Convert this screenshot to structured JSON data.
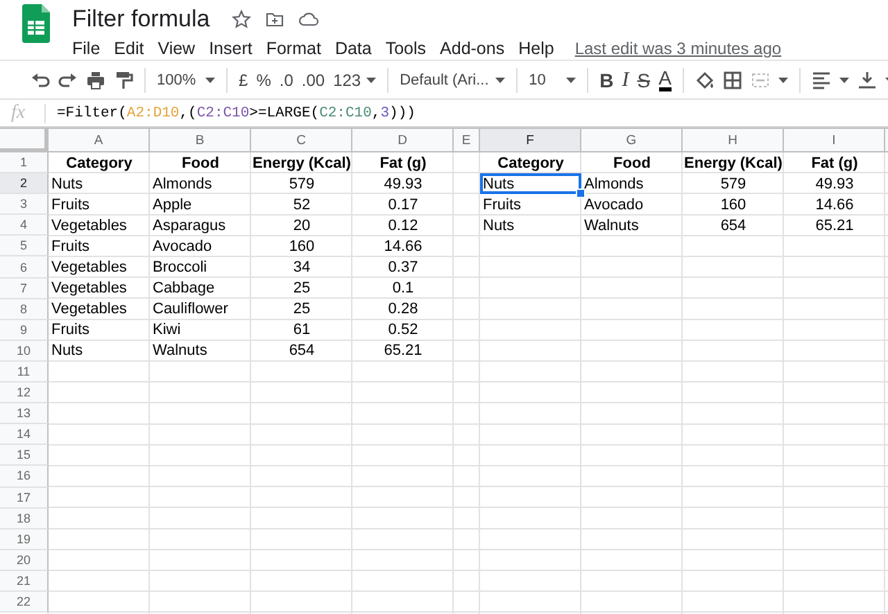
{
  "document": {
    "title": "Filter formula",
    "menu": [
      "File",
      "Edit",
      "View",
      "Insert",
      "Format",
      "Data",
      "Tools",
      "Add-ons",
      "Help"
    ],
    "last_edit": "Last edit was 3 minutes ago"
  },
  "toolbar": {
    "zoom": "100%",
    "currency": "£",
    "percent": "%",
    "decrease_decimals": ".0",
    "increase_decimals": ".00",
    "number_format": "123",
    "font": "Default (Ari...",
    "font_size": "10",
    "bold": "B",
    "italic": "I",
    "strikethrough": "S",
    "text_color": "A"
  },
  "formula_bar": {
    "fx": "fx",
    "formula": [
      {
        "text": "=Filter("
      },
      {
        "text": "A2:D10",
        "color": "#e3a33b"
      },
      {
        "text": ",("
      },
      {
        "text": "C2:C10",
        "color": "#7b56a8"
      },
      {
        "text": ">=LARGE("
      },
      {
        "text": "C2:C10",
        "color": "#4a8a74"
      },
      {
        "text": ","
      },
      {
        "text": "3",
        "color": "#6a52c4"
      },
      {
        "text": ")))"
      }
    ]
  },
  "sheet": {
    "columns": [
      {
        "label": "A",
        "kind": "text",
        "selected": false
      },
      {
        "label": "B",
        "kind": "text",
        "selected": false
      },
      {
        "label": "C",
        "kind": "number",
        "selected": false
      },
      {
        "label": "D",
        "kind": "number",
        "selected": false
      },
      {
        "label": "E",
        "kind": "narrow",
        "selected": false
      },
      {
        "label": "F",
        "kind": "text",
        "selected": true
      },
      {
        "label": "G",
        "kind": "text",
        "selected": false
      },
      {
        "label": "H",
        "kind": "number",
        "selected": false
      },
      {
        "label": "I",
        "kind": "number",
        "selected": false
      }
    ],
    "rows": [
      {
        "label": "1",
        "kind": "header",
        "selected": false,
        "cells": [
          "Category",
          "Food",
          "Energy (Kcal)",
          "Fat (g)",
          "",
          "Category",
          "Food",
          "Energy (Kcal)",
          "Fat (g)"
        ]
      },
      {
        "label": "2",
        "kind": "data",
        "selected": true,
        "cells": [
          "Nuts",
          "Almonds",
          "579",
          "49.93",
          "",
          "Nuts",
          "Almonds",
          "579",
          "49.93"
        ]
      },
      {
        "label": "3",
        "kind": "data",
        "selected": false,
        "cells": [
          "Fruits",
          "Apple",
          "52",
          "0.17",
          "",
          "Fruits",
          "Avocado",
          "160",
          "14.66"
        ]
      },
      {
        "label": "4",
        "kind": "data",
        "selected": false,
        "cells": [
          "Vegetables",
          "Asparagus",
          "20",
          "0.12",
          "",
          "Nuts",
          "Walnuts",
          "654",
          "65.21"
        ]
      },
      {
        "label": "5",
        "kind": "data",
        "selected": false,
        "cells": [
          "Fruits",
          "Avocado",
          "160",
          "14.66"
        ]
      },
      {
        "label": "6",
        "kind": "data",
        "selected": false,
        "cells": [
          "Vegetables",
          "Broccoli",
          "34",
          "0.37"
        ]
      },
      {
        "label": "7",
        "kind": "data",
        "selected": false,
        "cells": [
          "Vegetables",
          "Cabbage",
          "25",
          "0.1"
        ]
      },
      {
        "label": "8",
        "kind": "data",
        "selected": false,
        "cells": [
          "Vegetables",
          "Cauliflower",
          "25",
          "0.28"
        ]
      },
      {
        "label": "9",
        "kind": "data",
        "selected": false,
        "cells": [
          "Fruits",
          "Kiwi",
          "61",
          "0.52"
        ]
      },
      {
        "label": "10",
        "kind": "data",
        "selected": false,
        "cells": [
          "Nuts",
          "Walnuts",
          "654",
          "65.21"
        ]
      },
      {
        "label": "11",
        "kind": "data",
        "selected": false
      },
      {
        "label": "12",
        "kind": "data",
        "selected": false
      },
      {
        "label": "13",
        "kind": "data",
        "selected": false
      },
      {
        "label": "14",
        "kind": "data",
        "selected": false
      },
      {
        "label": "15",
        "kind": "data",
        "selected": false
      },
      {
        "label": "16",
        "kind": "data",
        "selected": false
      },
      {
        "label": "17",
        "kind": "data",
        "selected": false
      },
      {
        "label": "18",
        "kind": "data",
        "selected": false
      },
      {
        "label": "19",
        "kind": "data",
        "selected": false
      },
      {
        "label": "20",
        "kind": "data",
        "selected": false
      },
      {
        "label": "21",
        "kind": "data",
        "selected": false
      },
      {
        "label": "22",
        "kind": "data",
        "selected": false
      }
    ]
  }
}
